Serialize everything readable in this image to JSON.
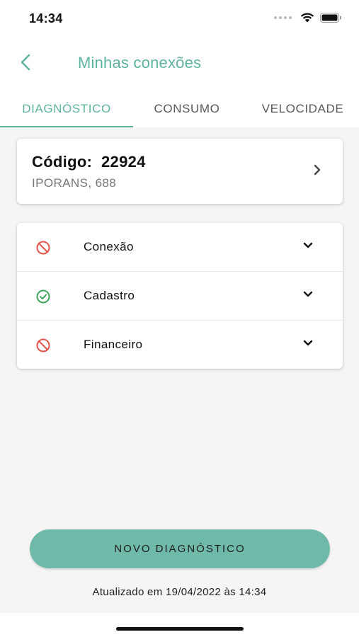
{
  "status_bar": {
    "time": "14:34"
  },
  "header": {
    "title": "Minhas conexões",
    "back_icon": "chevron-left-icon"
  },
  "tabs": [
    {
      "label": "DIAGNÓSTICO",
      "active": true
    },
    {
      "label": "CONSUMO",
      "active": false
    },
    {
      "label": "VELOCIDADE",
      "active": false
    }
  ],
  "connection": {
    "code_label": "Código:",
    "code_value": "22924",
    "address": "IPORANS, 688"
  },
  "diagnostics": [
    {
      "label": "Conexão",
      "status": "error",
      "icon": "blocked-icon"
    },
    {
      "label": "Cadastro",
      "status": "ok",
      "icon": "check-circle-icon"
    },
    {
      "label": "Financeiro",
      "status": "error",
      "icon": "blocked-icon"
    }
  ],
  "actions": {
    "new_diagnostic": "NOVO DIAGNÓSTICO"
  },
  "footer": {
    "updated_text": "Atualizado em 19/04/2022 às 14:34"
  },
  "colors": {
    "accent": "#5fb4a0",
    "button": "#6fb9a8",
    "error": "#e5534b",
    "success": "#3fa55a"
  }
}
